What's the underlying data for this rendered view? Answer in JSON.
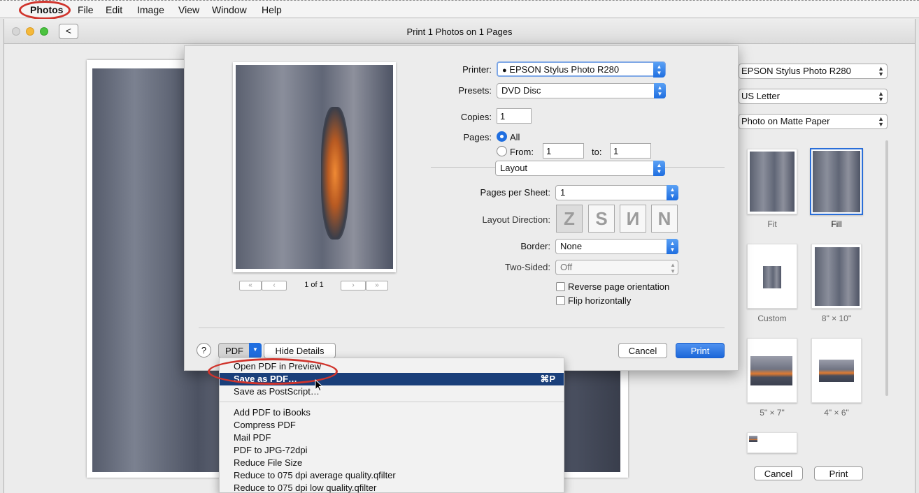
{
  "menubar": {
    "items": [
      "Photos",
      "File",
      "Edit",
      "Image",
      "View",
      "Window",
      "Help"
    ]
  },
  "window": {
    "title": "Print 1 Photos on 1 Pages",
    "back_label": "<"
  },
  "right_panel": {
    "printer": "EPSON Stylus Photo R280",
    "paper_size": "US Letter",
    "paper_type": "Photo on Matte Paper",
    "thumbnails": [
      "Fit",
      "Fill",
      "Custom",
      "8\" × 10\"",
      "5\" × 7\"",
      "4\" × 6\""
    ],
    "cancel_label": "Cancel",
    "print_label": "Print"
  },
  "sheet": {
    "printer_label": "Printer:",
    "printer_value": "EPSON Stylus Photo R280",
    "presets_label": "Presets:",
    "presets_value": "DVD Disc",
    "copies_label": "Copies:",
    "copies_value": "1",
    "pages_label": "Pages:",
    "pages_all": "All",
    "pages_from": "From:",
    "pages_from_value": "1",
    "pages_to": "to:",
    "pages_to_value": "1",
    "section_value": "Layout",
    "pps_label": "Pages per Sheet:",
    "pps_value": "1",
    "layout_direction_label": "Layout Direction:",
    "border_label": "Border:",
    "border_value": "None",
    "two_sided_label": "Two-Sided:",
    "two_sided_value": "Off",
    "reverse_label": "Reverse page orientation",
    "flip_label": "Flip horizontally",
    "page_indicator": "1 of 1",
    "help_label": "?",
    "pdf_label": "PDF",
    "hide_details_label": "Hide Details",
    "cancel_label": "Cancel",
    "print_label": "Print"
  },
  "pdf_menu": {
    "items": [
      {
        "label": "Open PDF in Preview",
        "shortcut": ""
      },
      {
        "label": "Save as PDF…",
        "shortcut": "⌘P"
      },
      {
        "label": "Save as PostScript…",
        "shortcut": ""
      },
      {
        "label": "Add PDF to iBooks",
        "shortcut": ""
      },
      {
        "label": "Compress PDF",
        "shortcut": ""
      },
      {
        "label": "Mail PDF",
        "shortcut": ""
      },
      {
        "label": "PDF to JPG-72dpi",
        "shortcut": ""
      },
      {
        "label": "Reduce File Size",
        "shortcut": ""
      },
      {
        "label": "Reduce to 075 dpi average quality.qfilter",
        "shortcut": ""
      },
      {
        "label": "Reduce to 075 dpi low quality.qfilter",
        "shortcut": ""
      }
    ]
  },
  "colors": {
    "accent": "#1f6ee0",
    "highlight": "#1a3f7a",
    "annotation": "#d0342c"
  }
}
